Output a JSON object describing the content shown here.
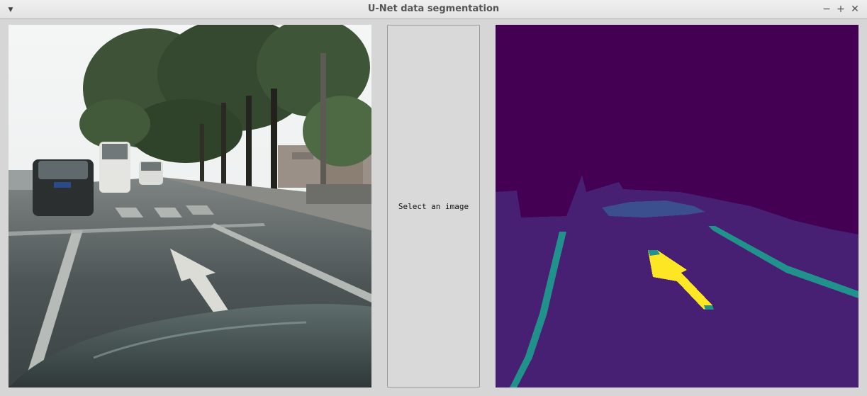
{
  "window": {
    "title": "U-Net data segmentation",
    "menu_icon": "chevron-down-icon",
    "controls": {
      "minimize": "−",
      "maximize": "+",
      "close": "✕"
    }
  },
  "input_image": {
    "kind": "photo",
    "content": "rainy street with cars and road arrow"
  },
  "action_button": {
    "label": "Select an image"
  },
  "segmentation": {
    "colors": {
      "background": "#440154",
      "road": "#482073",
      "car": "#3b4f8f",
      "lane": "#21918c",
      "arrow": "#fde725"
    }
  }
}
